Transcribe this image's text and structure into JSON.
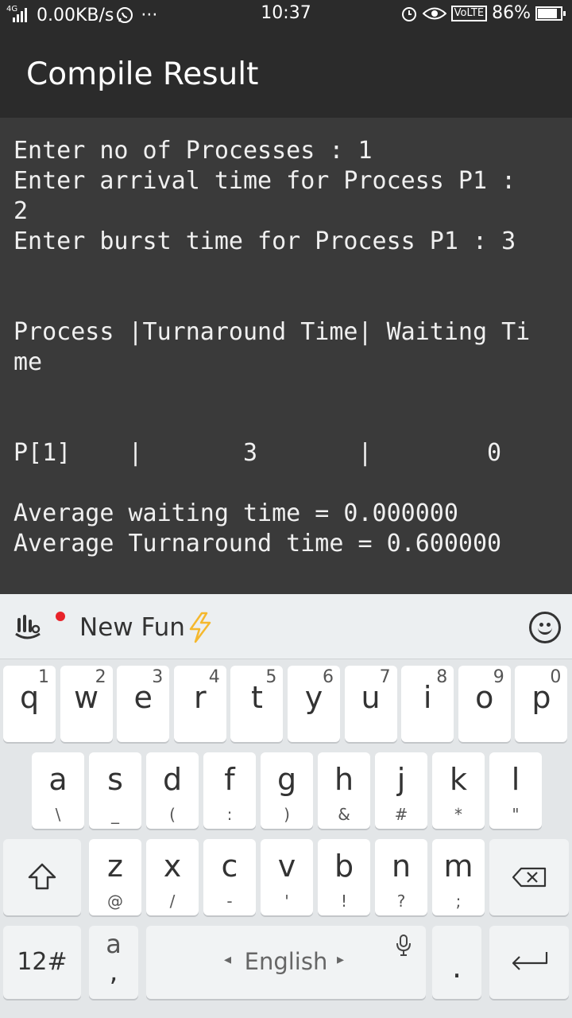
{
  "status_bar": {
    "network": "4G",
    "speed": "0.00KB/s",
    "more": "···",
    "time": "10:37",
    "volte": "VoLTE",
    "battery": "86%",
    "battery_level": 0.86
  },
  "app_bar": {
    "title": "Compile Result"
  },
  "output": {
    "lines": [
      "Enter no of Processes : 1",
      "Enter arrival time for Process P1 :",
      "2",
      "Enter burst time for Process P1 : 3",
      "Process |Turnaround Time| Waiting Ti",
      "me",
      "P[1]    |       3       |        0",
      "Average waiting time = 0.000000",
      "Average Turnaround time = 0.600000"
    ]
  },
  "keyboard": {
    "toolbar_label": "New Fun",
    "row1": [
      {
        "key": "q",
        "num": "1"
      },
      {
        "key": "w",
        "num": "2"
      },
      {
        "key": "e",
        "num": "3"
      },
      {
        "key": "r",
        "num": "4"
      },
      {
        "key": "t",
        "num": "5"
      },
      {
        "key": "y",
        "num": "6"
      },
      {
        "key": "u",
        "num": "7"
      },
      {
        "key": "i",
        "num": "8"
      },
      {
        "key": "o",
        "num": "9"
      },
      {
        "key": "p",
        "num": "0"
      }
    ],
    "row2": [
      {
        "key": "a",
        "sub": "\\"
      },
      {
        "key": "s",
        "sub": "_"
      },
      {
        "key": "d",
        "sub": "("
      },
      {
        "key": "f",
        "sub": ":"
      },
      {
        "key": "g",
        "sub": ")"
      },
      {
        "key": "h",
        "sub": "&"
      },
      {
        "key": "j",
        "sub": "#"
      },
      {
        "key": "k",
        "sub": "*"
      },
      {
        "key": "l",
        "sub": "\""
      }
    ],
    "row3": [
      {
        "key": "z",
        "sub": "@"
      },
      {
        "key": "x",
        "sub": "/"
      },
      {
        "key": "c",
        "sub": "-"
      },
      {
        "key": "v",
        "sub": "'"
      },
      {
        "key": "b",
        "sub": "!"
      },
      {
        "key": "n",
        "sub": "?"
      },
      {
        "key": "m",
        "sub": ";"
      }
    ],
    "symbols_label": "12#",
    "comma_key": {
      "key": "a",
      "sub": ","
    },
    "space_label": "English",
    "period_label": "."
  }
}
